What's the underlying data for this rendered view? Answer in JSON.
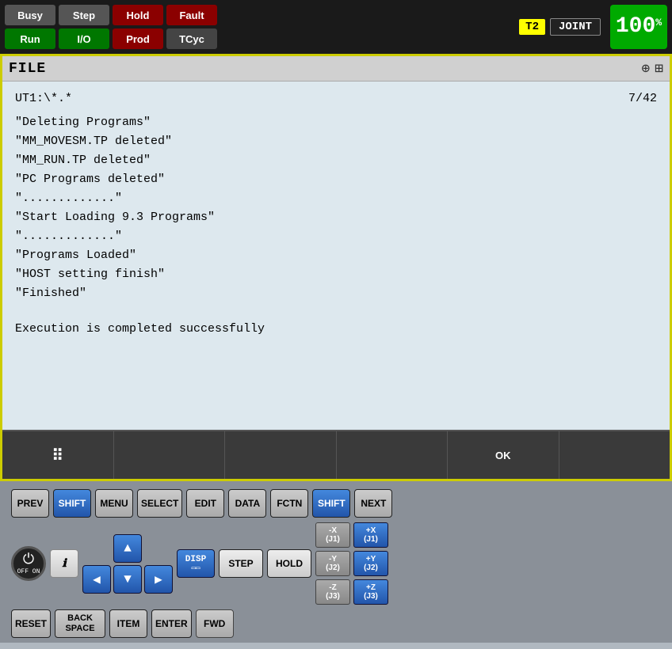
{
  "statusBar": {
    "buttons": [
      {
        "id": "busy",
        "label": "Busy",
        "style": "gray"
      },
      {
        "id": "run",
        "label": "Run",
        "style": "green"
      },
      {
        "id": "step",
        "label": "Step",
        "style": "gray"
      },
      {
        "id": "io",
        "label": "I/O",
        "style": "green"
      },
      {
        "id": "hold",
        "label": "Hold",
        "style": "red"
      },
      {
        "id": "prod",
        "label": "Prod",
        "style": "red"
      },
      {
        "id": "fault",
        "label": "Fault",
        "style": "red"
      },
      {
        "id": "tcyc",
        "label": "TCyc",
        "style": "gray"
      }
    ],
    "t2": "T2",
    "joint": "JOINT",
    "percent": "100",
    "percentSign": "%"
  },
  "fileHeader": {
    "title": "FILE",
    "zoomIcon": "⊕",
    "gridIcon": "⊞"
  },
  "content": {
    "path": "UT1:\\*.*",
    "position": "7/42",
    "lines": [
      "\"Deleting Programs\"",
      "\"MM_MOVESM.TP deleted\"",
      "\"MM_RUN.TP deleted\"",
      "\"PC Programs deleted\"",
      "\".............\"",
      "\"Start Loading 9.3 Programs\"",
      "\".............\"",
      "\"Programs Loaded\"",
      "\"HOST setting finish\"",
      "\"Finished\"",
      "",
      "Execution is completed successfully"
    ]
  },
  "funcBar": {
    "buttons": [
      {
        "id": "grid",
        "label": "⠿",
        "isGrid": true
      },
      {
        "id": "f2",
        "label": ""
      },
      {
        "id": "f3",
        "label": ""
      },
      {
        "id": "f4",
        "label": ""
      },
      {
        "id": "ok",
        "label": "OK"
      },
      {
        "id": "f6",
        "label": ""
      }
    ]
  },
  "keyboard": {
    "row1": [
      {
        "id": "prev",
        "label": "PREV",
        "style": "gray"
      },
      {
        "id": "shift1",
        "label": "SHIFT",
        "style": "blue"
      },
      {
        "id": "menu",
        "label": "MENU",
        "style": "gray"
      },
      {
        "id": "select",
        "label": "SELECT",
        "style": "gray"
      },
      {
        "id": "edit",
        "label": "EDIT",
        "style": "gray"
      },
      {
        "id": "data",
        "label": "DATA",
        "style": "gray"
      },
      {
        "id": "fctn",
        "label": "FCTN",
        "style": "gray"
      },
      {
        "id": "shift2",
        "label": "SHIFT",
        "style": "blue"
      },
      {
        "id": "next",
        "label": "NEXT",
        "style": "gray"
      }
    ],
    "row2_left": [
      {
        "id": "info",
        "label": "i",
        "style": "info"
      },
      {
        "id": "disp",
        "label": "DISP",
        "style": "blue"
      }
    ],
    "arrowKeys": {
      "up": "▲",
      "left": "◀",
      "right": "▶",
      "down": "▼"
    },
    "row2_right": [
      {
        "id": "step",
        "label": "STEP",
        "style": "gray"
      },
      {
        "id": "hold",
        "label": "HOLD",
        "style": "gray"
      }
    ],
    "axisButtons": [
      {
        "neg": "-X\n(J1)",
        "pos": "+X\n(J1)"
      },
      {
        "neg": "-Y\n(J2)",
        "pos": "+Y\n(J2)"
      },
      {
        "neg": "-Z\n(J3)",
        "pos": "+Z\n(J3)"
      }
    ],
    "row3": [
      {
        "id": "reset",
        "label": "RESET",
        "style": "gray"
      },
      {
        "id": "backspace",
        "label": "BACK\nSPACE",
        "style": "gray"
      },
      {
        "id": "item",
        "label": "ITEM",
        "style": "gray"
      },
      {
        "id": "enter",
        "label": "ENTER",
        "style": "gray"
      },
      {
        "id": "fwd",
        "label": "FWD",
        "style": "gray"
      }
    ],
    "powerLabel": "OFF ON"
  }
}
